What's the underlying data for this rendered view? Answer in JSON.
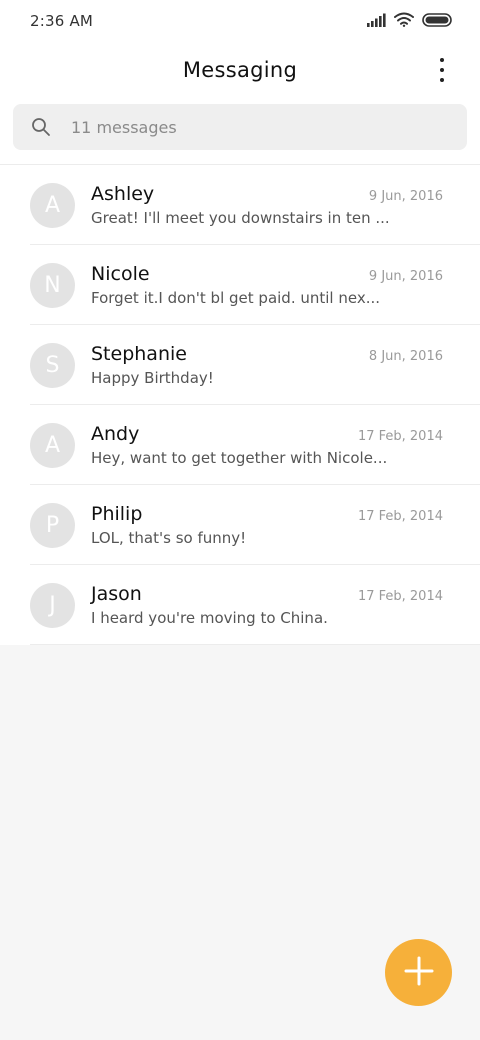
{
  "status_bar": {
    "time": "2:36 AM",
    "icons": [
      "signal-icon",
      "wifi-icon",
      "battery-icon"
    ]
  },
  "header": {
    "title": "Messaging",
    "menu_icon": "more-vertical-icon"
  },
  "search": {
    "placeholder": "11 messages",
    "icon": "search-icon"
  },
  "conversations": [
    {
      "initial": "A",
      "name": "Ashley",
      "date": "9 Jun, 2016",
      "preview": "Great! I'll meet you downstairs in ten ..."
    },
    {
      "initial": "N",
      "name": "Nicole",
      "date": "9 Jun, 2016",
      "preview": "Forget it.I don't bl get paid. until nex..."
    },
    {
      "initial": "S",
      "name": "Stephanie",
      "date": "8 Jun, 2016",
      "preview": "Happy Birthday!"
    },
    {
      "initial": "A",
      "name": "Andy",
      "date": "17 Feb, 2014",
      "preview": "Hey, want to get together with Nicole..."
    },
    {
      "initial": "P",
      "name": "Philip",
      "date": "17 Feb, 2014",
      "preview": "LOL, that's so funny!"
    },
    {
      "initial": "J",
      "name": "Jason",
      "date": "17 Feb, 2014",
      "preview": "I heard you're moving to China."
    }
  ],
  "fab": {
    "icon": "plus-icon"
  },
  "colors": {
    "accent": "#f6b03a",
    "avatar": "#e3e3e3",
    "background": "#f6f6f6"
  }
}
